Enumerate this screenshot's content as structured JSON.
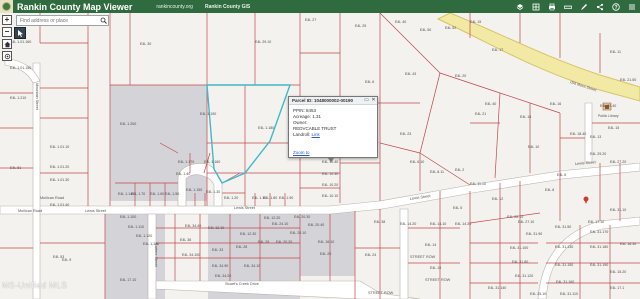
{
  "header": {
    "app_title": "Rankin County Map Viewer",
    "link_site": "rankincounty.org",
    "link_gis": "Rankin County GIS",
    "tools": [
      "layers-icon",
      "basemap-icon",
      "print-icon",
      "measure-icon",
      "draw-icon",
      "share-icon",
      "help-icon",
      "menu-icon"
    ]
  },
  "search": {
    "placeholder": "Find address or place"
  },
  "popup": {
    "title": "Parcel ID: 1048000002-00190",
    "lines": [
      "PPIN: 8453",
      "Acreage: 1.31",
      "Owner:",
      "REDVCABLE TRUST"
    ],
    "landroll_label": "Landroll:",
    "landroll_link": "Link",
    "zoom_link": "Zoom to"
  },
  "map_labels": {
    "roads": [
      "Mullican Road",
      "Lewis Street",
      "Lewis Street",
      "Lewis Street",
      "Lewis Street",
      "Lewis Street",
      "Mullican Road",
      "Old Moss Street",
      "Carters Street",
      "Mountain Street",
      "Stuart's Creek Drive"
    ],
    "parcels": [
      "E4L 27",
      "E4L 25",
      "E4L 40",
      "E4L 50",
      "E4L 52",
      "E4L 30",
      "E4L 29.10",
      "E4L 17",
      "E4L 11",
      "E4L 15",
      "E4L 43",
      "E4L 20",
      "E4L 40",
      "E4L 6",
      "E4L 1.210",
      "E4L 1.200",
      "E4L 1.190",
      "E4L 1.180",
      "E4L 1.170",
      "E4L 1.160",
      "E4L 1.150",
      "E4L 23",
      "E4L 21",
      "E4L 18",
      "E4L 16",
      "E4L 10",
      "E4L 6",
      "E4L 1.140",
      "E4L 10.40",
      "E4L 10.30",
      "E4L 10.20",
      "E4L 10.10",
      "E4L 6.10",
      "E4L 8.11",
      "E4L 2",
      "E4L 11.10",
      "E4L 12",
      "E4L 8",
      "E4L 5",
      "E4L 22.10",
      "E4L 33",
      "E4L 28",
      "E4L 26",
      "E4L 24.10",
      "E4L 20.20",
      "E4L 20.10",
      "E4L 20",
      "E4L 24",
      "E4L 14",
      "E4L 10",
      "E4L 9",
      "E4L 1.70",
      "E4L 1.60",
      "E4L 1.50",
      "E4L 1.40",
      "E4L 1.30",
      "E4L 1.20",
      "E4L 1.10",
      "E4L 1.80",
      "E4L 1.90",
      "E4L 1.100",
      "E4L 1.110",
      "E4L 1.120",
      "E4L 1.130",
      "E4L 20.30",
      "E4L 38",
      "E4L 31.90",
      "E4L 31.100",
      "E4L 31.80",
      "E4L 31.120",
      "E4L 31.130",
      "E4L 31.150",
      "E4L 31.160",
      "E4L 31.170",
      "E4L 31.180",
      "E4L 31.190",
      "E4L 27.10",
      "E4L 20.40",
      "E4L 36",
      "E4L 34.100",
      "E4L 34.90",
      "E4L 34.20",
      "E4L 34.10",
      "E4L 34.40",
      "E4L 17.10",
      "E4L 12.10",
      "E4L 12.30",
      "E4L 12.20",
      "E4L 16.10",
      "E4L 1.01.40",
      "E4L 1.01.30",
      "E4L 1.01.20",
      "E4L 1.01.10",
      "E4L 1.01.150",
      "E4L 1.01.160",
      "E4L 18.40",
      "E4L 13",
      "E4L 15",
      "E4L 51",
      "E4L 53",
      "E4L 14.20",
      "E4L 14.10",
      "E4L 14.30",
      "E4L 31.50",
      "E4L 31.110",
      "E4L 31.140",
      "E4L 31.10",
      "E4L 17.10",
      "E4L 15.20",
      "E4L 17.1",
      "E4L 16.30",
      "E4L 25.10",
      "E4L 23.40",
      "E4L 21.50",
      "E4L 29.20",
      "E4L 27.20",
      "E4L 31.30",
      "E4L 19.10",
      "E4L 19"
    ],
    "places": [
      "STREET ROW",
      "STREET ROW",
      "STREET ROW",
      "ROW AREA"
    ],
    "poi": "Public Library"
  },
  "watermark": "MS-Unified MLS",
  "colors": {
    "header_bg": "#2f6b3f",
    "parcel_line": "#c2474a",
    "road_fill": "#ffffff",
    "highway_fill": "#f1e9a4",
    "highway_edge": "#d8c465",
    "selection": "#3fb8c9",
    "shaded_parcel": "#d4d4d8",
    "map_bg": "#f4f2ee"
  }
}
